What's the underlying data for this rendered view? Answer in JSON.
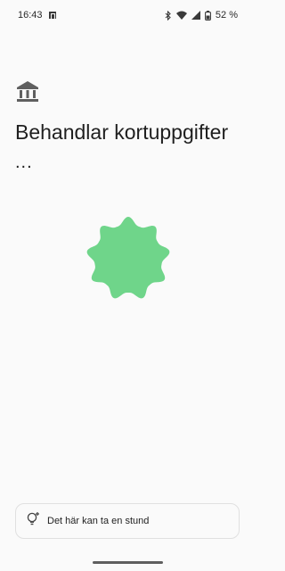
{
  "status_bar": {
    "time": "16:43",
    "notification_icon": "wallet-card-icon",
    "icons": [
      "bluetooth-icon",
      "wifi-icon",
      "signal-icon",
      "battery-icon"
    ],
    "battery_percent": "52 %"
  },
  "main": {
    "icon": "bank-icon",
    "title": "Behandlar kortuppgifter",
    "ellipsis": "..."
  },
  "loader": {
    "icon": "scalloped-star-loading-icon",
    "color": "#6fd58a"
  },
  "hint": {
    "icon": "lightbulb-sparkle-icon",
    "text": "Det här kan ta en stund"
  }
}
